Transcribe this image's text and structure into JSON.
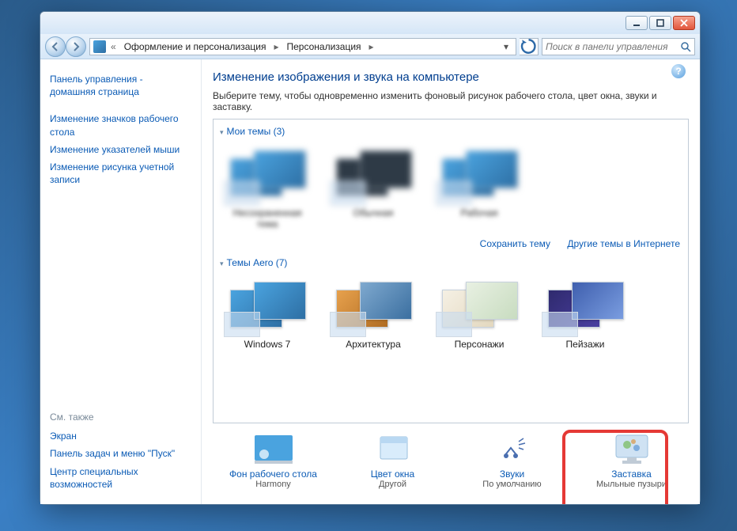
{
  "breadcrumb": {
    "prefix": "«",
    "seg1": "Оформление и персонализация",
    "seg2": "Персонализация"
  },
  "search": {
    "placeholder": "Поиск в панели управления"
  },
  "leftnav": {
    "home1": "Панель управления -",
    "home2": "домашняя страница",
    "l1a": "Изменение значков рабочего",
    "l1b": "стола",
    "l2": "Изменение указателей мыши",
    "l3a": "Изменение рисунка учетной",
    "l3b": "записи",
    "seealso": "См. также",
    "s1": "Экран",
    "s2": "Панель задач и меню \"Пуск\"",
    "s3a": "Центр специальных",
    "s3b": "возможностей"
  },
  "heading": "Изменение изображения и звука на компьютере",
  "description": "Выберите тему, чтобы одновременно изменить фоновый рисунок рабочего стола, цвет окна, звуки и заставку.",
  "groups": {
    "my": "Мои темы (3)",
    "aero": "Темы Aero (7)"
  },
  "mythemes": [
    {
      "label": "Несохраненная тема"
    },
    {
      "label": "Обычная"
    },
    {
      "label": "Рабочая"
    }
  ],
  "links": {
    "save": "Сохранить тему",
    "online": "Другие темы в Интернете"
  },
  "aero": [
    {
      "label": "Windows 7"
    },
    {
      "label": "Архитектура"
    },
    {
      "label": "Персонажи"
    },
    {
      "label": "Пейзажи"
    }
  ],
  "bottom": {
    "bg": {
      "label": "Фон рабочего стола",
      "sub": "Harmony"
    },
    "color": {
      "label": "Цвет окна",
      "sub": "Другой"
    },
    "sound": {
      "label": "Звуки",
      "sub": "По умолчанию"
    },
    "saver": {
      "label": "Заставка",
      "sub": "Мыльные пузыри"
    }
  }
}
